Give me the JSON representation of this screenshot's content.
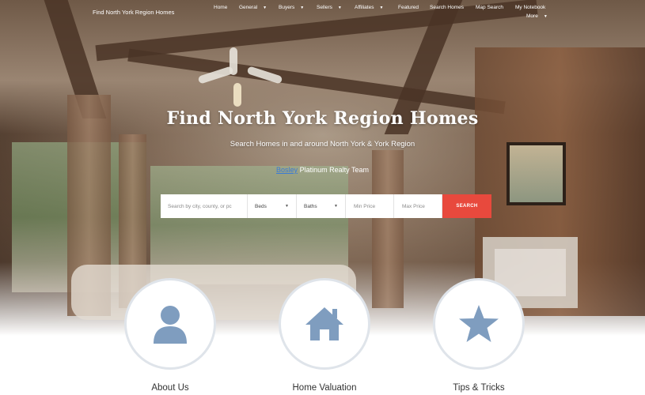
{
  "header": {
    "site_name": "Find North York Region Homes",
    "nav": [
      {
        "label": "Home",
        "dropdown": false
      },
      {
        "label": "General",
        "dropdown": true
      },
      {
        "label": "Buyers",
        "dropdown": true
      },
      {
        "label": "Sellers",
        "dropdown": true
      },
      {
        "label": "Affiliates",
        "dropdown": true
      },
      {
        "label": "Featured",
        "dropdown": false
      },
      {
        "label": "Search Homes",
        "dropdown": false
      },
      {
        "label": "Map Search",
        "dropdown": false
      },
      {
        "label": "My Notebook",
        "dropdown": false
      },
      {
        "label": "More",
        "dropdown": true
      }
    ]
  },
  "hero": {
    "title": "Find North York Region Homes",
    "subtitle": "Search Homes in and around North York & York Region",
    "team_brand": "Bosley",
    "team_name": "Platinum Realty Team"
  },
  "search": {
    "placeholder": "Search by city, county, or pc",
    "beds_label": "Beds",
    "baths_label": "Baths",
    "min_price_placeholder": "Min Price",
    "max_price_placeholder": "Max Price",
    "button_label": "SEARCH"
  },
  "features": [
    {
      "label": "About Us",
      "icon": "user-icon"
    },
    {
      "label": "Home Valuation",
      "icon": "home-icon"
    },
    {
      "label": "Tips & Tricks",
      "icon": "star-icon"
    }
  ],
  "colors": {
    "accent": "#e8493d",
    "icon": "#7f9dbf",
    "circle_border": "#dfe4ea",
    "brand_link": "#3a7bd5"
  }
}
